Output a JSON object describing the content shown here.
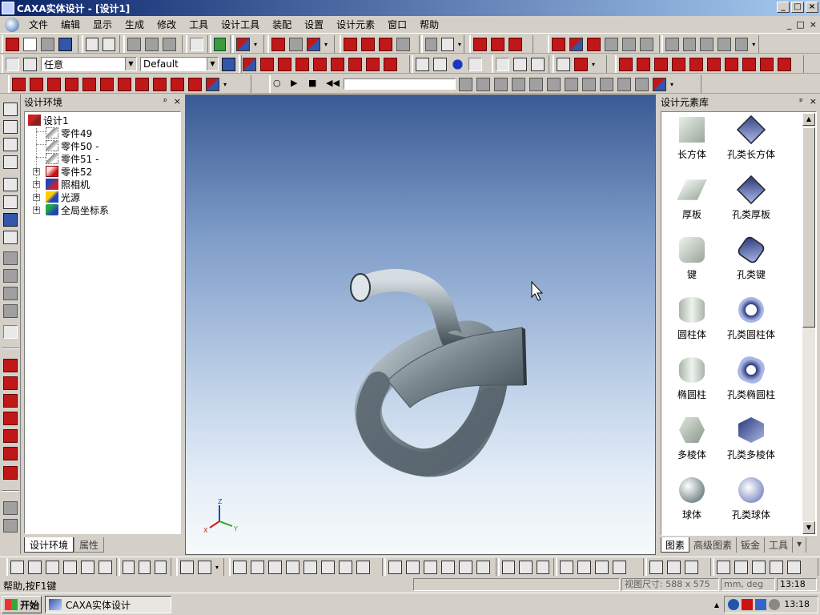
{
  "window": {
    "title": "CAXA实体设计 - [设计1]",
    "min_label": "_",
    "max_label": "□",
    "close_label": "×"
  },
  "menu": {
    "items": [
      "文件",
      "编辑",
      "显示",
      "生成",
      "修改",
      "工具",
      "设计工具",
      "装配",
      "设置",
      "设计元素",
      "窗口",
      "帮助"
    ],
    "mdi_min": "_",
    "mdi_restore": "□",
    "mdi_close": "×"
  },
  "toolbar2": {
    "select_mode": "任意",
    "style": "Default"
  },
  "design_env": {
    "title": "设计环境",
    "pin": "ᵖ",
    "close": "×",
    "tree": {
      "root": "设计1",
      "children": [
        "零件49",
        "零件50 -",
        "零件51 -",
        "零件52",
        "照相机",
        "光源",
        "全局坐标系"
      ]
    },
    "tabs": [
      "设计环境",
      "属性"
    ]
  },
  "viewport": {
    "axis_z": "Z",
    "axis_x": "X",
    "axis_y": "Y",
    "colors": {
      "tube": "#5a6770",
      "tube_highlight": "#c5cfd5",
      "background_top": "#3a5a94",
      "background_bottom": "#f6fafb"
    }
  },
  "library": {
    "title": "设计元素库",
    "pin": "ᵖ",
    "close": "×",
    "items": [
      {
        "label": "长方体",
        "icon": "box-icon"
      },
      {
        "label": "孔类长方体",
        "icon": "box-hole-icon"
      },
      {
        "label": "厚板",
        "icon": "plate-icon"
      },
      {
        "label": "孔类厚板",
        "icon": "plate-hole-icon"
      },
      {
        "label": "键",
        "icon": "key-icon"
      },
      {
        "label": "孔类键",
        "icon": "key-hole-icon"
      },
      {
        "label": "圆柱体",
        "icon": "cylinder-icon"
      },
      {
        "label": "孔类圆柱体",
        "icon": "cylinder-hole-icon"
      },
      {
        "label": "椭圆柱",
        "icon": "elliptic-cylinder-icon"
      },
      {
        "label": "孔类椭圆柱",
        "icon": "elliptic-cylinder-hole-icon"
      },
      {
        "label": "多棱体",
        "icon": "polyhedron-icon"
      },
      {
        "label": "孔类多棱体",
        "icon": "polyhedron-hole-icon"
      },
      {
        "label": "球体",
        "icon": "sphere-icon"
      },
      {
        "label": "孔类球体",
        "icon": "sphere-hole-icon"
      }
    ],
    "tabs": [
      "图素",
      "高级图素",
      "钣金",
      "工具"
    ],
    "tabs_more": "▾"
  },
  "status": {
    "help": "帮助,按F1键",
    "view_size": "视图尺寸: 588 x 575",
    "units": "mm, deg",
    "time": "13:18"
  },
  "taskbar": {
    "start": "开始",
    "task": "CAXA实体设计",
    "clock": "13:18"
  }
}
